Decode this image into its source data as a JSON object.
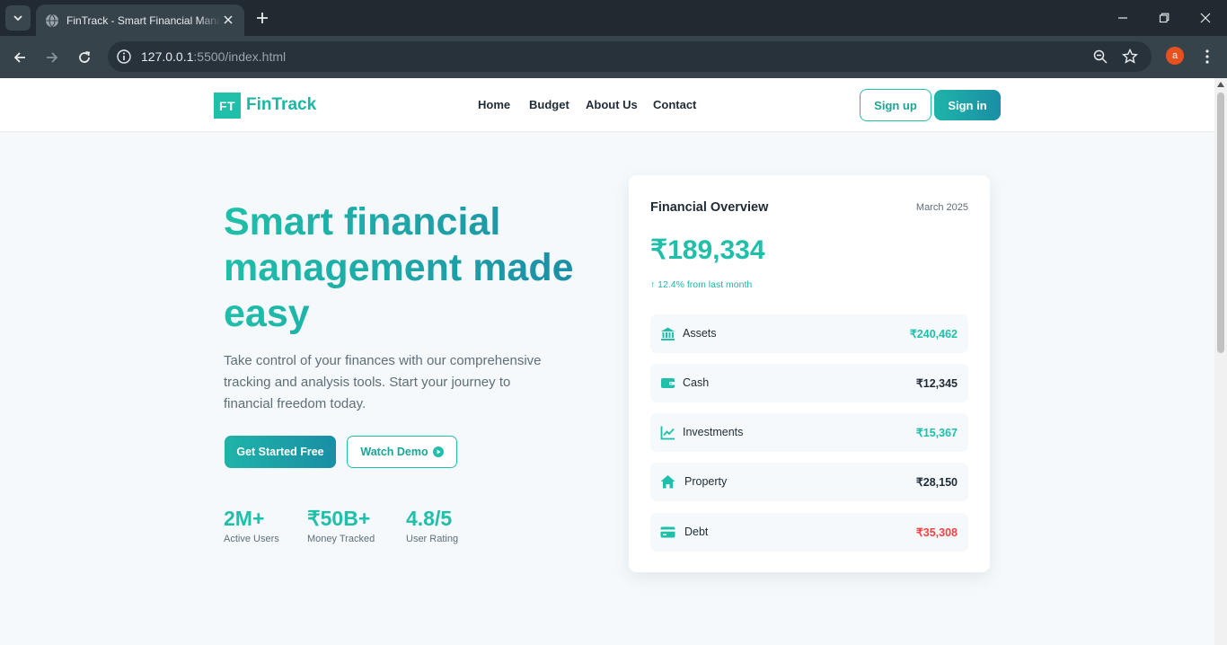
{
  "browser": {
    "tab_title": "FinTrack - Smart Financial Management",
    "url_host": "127.0.0.1",
    "url_path": ":5500/index.html",
    "profile_initial": "a"
  },
  "site": {
    "logo_mark": "FT",
    "logo_text": "FinTrack",
    "nav": [
      "Home",
      "Budget",
      "About Us",
      "Contact"
    ],
    "signup_label": "Sign up",
    "signin_label": "Sign in"
  },
  "hero": {
    "title": "Smart financial management made easy",
    "subtitle": "Take control of your finances with our comprehensive tracking and analysis tools. Start your journey to financial freedom today.",
    "primary_cta": "Get Started Free",
    "secondary_cta": "Watch Demo",
    "stats": [
      {
        "value": "2M+",
        "label": "Active Users"
      },
      {
        "value": "₹50B+",
        "label": "Money Tracked"
      },
      {
        "value": "4.8/5",
        "label": "User Rating"
      }
    ]
  },
  "overview": {
    "title": "Financial Overview",
    "date": "March 2025",
    "total": "₹189,334",
    "change": "↑ 12.4% from last month",
    "items": [
      {
        "label": "Assets",
        "value": "₹240,462",
        "icon": "bank-icon",
        "color": "#1fbfaa"
      },
      {
        "label": "Cash",
        "value": "₹12,345",
        "icon": "wallet-icon",
        "color": "#1f2b36"
      },
      {
        "label": "Investments",
        "value": "₹15,367",
        "icon": "chart-line-icon",
        "color": "#1fbfaa"
      },
      {
        "label": "Property",
        "value": "₹28,150",
        "icon": "home-icon",
        "color": "#1f2b36"
      },
      {
        "label": "Debt",
        "value": "₹35,308",
        "icon": "credit-card-icon",
        "color": "#ef4444"
      }
    ]
  },
  "colors": {
    "brand": "#1fbfaa",
    "brand_dark": "#1a8ea6",
    "negative": "#ef4444"
  }
}
